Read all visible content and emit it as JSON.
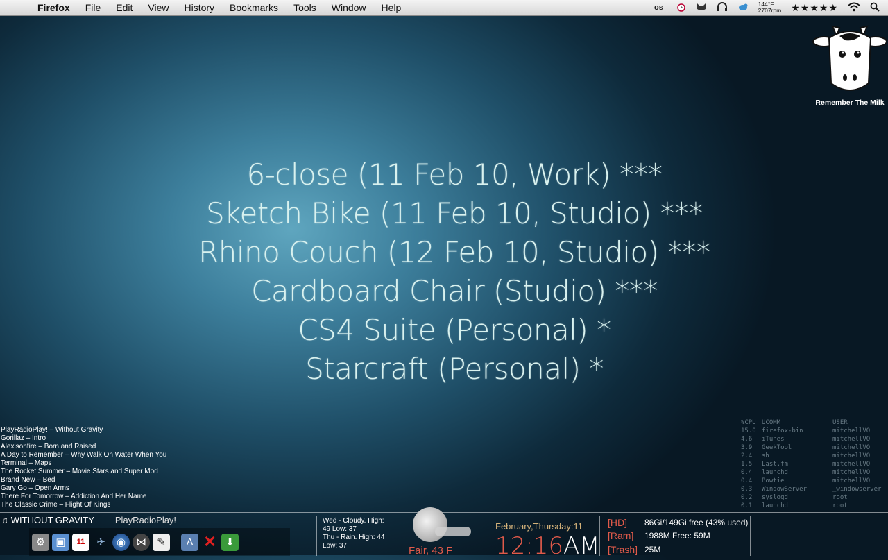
{
  "menubar": {
    "app": "Firefox",
    "menus": [
      "File",
      "Edit",
      "View",
      "History",
      "Bookmarks",
      "Tools",
      "Window",
      "Help"
    ],
    "status": {
      "temp": "144°F",
      "rpm": "2707rpm",
      "rating": "★★★★★"
    }
  },
  "rtm_widget": {
    "label": "Remember The Milk"
  },
  "tasks": [
    "6-close (11 Feb 10, Work) ***",
    "Sketch Bike (11 Feb 10, Studio) ***",
    "Rhino Couch (12 Feb 10, Studio) ***",
    "Cardboard Chair (Studio) ***",
    "CS4 Suite (Personal) *",
    "Starcraft (Personal) *"
  ],
  "recent_tracks": [
    "PlayRadioPlay! – Without Gravity",
    "Gorillaz – Intro",
    "Alexisonfire – Born and Raised",
    "A Day to Remember – Why Walk On Water When You",
    "Terminal – Maps",
    "The Rocket Summer – Movie Stars and Super Mod",
    "Brand New – Bed",
    "Gary Go – Open Arms",
    "There For Tomorrow – Addiction And Her Name",
    "The Classic Crime – Flight Of Kings"
  ],
  "processes": {
    "headers": [
      "%CPU",
      "UCOMM",
      "USER"
    ],
    "rows": [
      [
        "15.0",
        "firefox-bin",
        "mitchellVO"
      ],
      [
        "4.6",
        "iTunes",
        "mitchellVO"
      ],
      [
        "3.9",
        "GeekTool",
        "mitchellVO"
      ],
      [
        "2.4",
        "sh",
        "mitchellVO"
      ],
      [
        "1.5",
        "Last.fm",
        "mitchellVO"
      ],
      [
        "0.4",
        "launchd",
        "mitchellVO"
      ],
      [
        "0.4",
        "Bowtie",
        "mitchellVO"
      ],
      [
        "0.3",
        "WindowServer",
        "_windowserver"
      ],
      [
        "0.2",
        "syslogd",
        "root"
      ],
      [
        "0.1",
        "launchd",
        "root"
      ]
    ]
  },
  "now_playing": {
    "song": "WITHOUT GRAVITY",
    "artist": "PlayRadioPlay!"
  },
  "dock_icons": [
    "system-preferences-icon",
    "preview-icon",
    "ical-icon",
    "twitter-bird-icon",
    "firefox-icon",
    "bowtie-icon",
    "textedit-icon",
    "xcode-icon",
    "close-icon",
    "download-icon"
  ],
  "weather": {
    "forecast": [
      "Wed - Cloudy. High:",
      "49 Low: 37",
      "Thu - Rain. High: 44",
      "Low: 37"
    ],
    "current": "Fair, 43 F"
  },
  "clock": {
    "date": "February,Thursday:11",
    "time": "12:16",
    "ampm": "AM"
  },
  "system": [
    {
      "label": "[HD]",
      "value": "86Gi/149Gi free (43% used)"
    },
    {
      "label": "[Ram]",
      "value": "1988M Free: 59M"
    },
    {
      "label": "[Trash]",
      "value": "25M"
    }
  ],
  "colors": {
    "accent_red": "#e05a4a",
    "date_tan": "#d4b27a",
    "task_text": "#d9f2ef"
  }
}
